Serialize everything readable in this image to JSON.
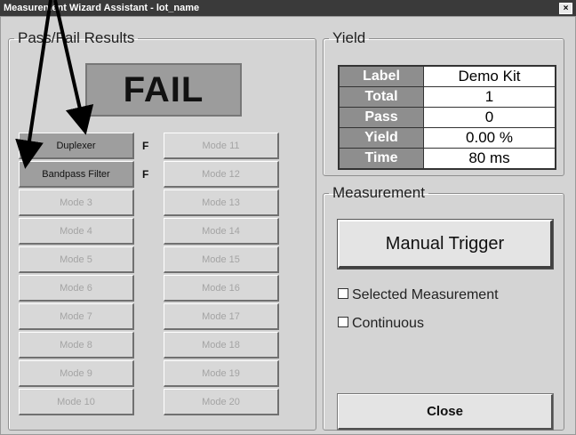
{
  "window": {
    "title": "Measurement Wizard Assistant - lot_name",
    "close_glyph": "×"
  },
  "pass_fail": {
    "legend": "Pass/Fail Results",
    "result": "FAIL",
    "modes_left": [
      {
        "label": "Duplexer",
        "status": "F",
        "active": true
      },
      {
        "label": "Bandpass Filter",
        "status": "F",
        "active": true
      },
      {
        "label": "Mode 3",
        "status": "",
        "active": false
      },
      {
        "label": "Mode 4",
        "status": "",
        "active": false
      },
      {
        "label": "Mode 5",
        "status": "",
        "active": false
      },
      {
        "label": "Mode 6",
        "status": "",
        "active": false
      },
      {
        "label": "Mode 7",
        "status": "",
        "active": false
      },
      {
        "label": "Mode 8",
        "status": "",
        "active": false
      },
      {
        "label": "Mode 9",
        "status": "",
        "active": false
      },
      {
        "label": "Mode 10",
        "status": "",
        "active": false
      }
    ],
    "modes_right": [
      {
        "label": "Mode 11"
      },
      {
        "label": "Mode 12"
      },
      {
        "label": "Mode 13"
      },
      {
        "label": "Mode 14"
      },
      {
        "label": "Mode 15"
      },
      {
        "label": "Mode 16"
      },
      {
        "label": "Mode 17"
      },
      {
        "label": "Mode 18"
      },
      {
        "label": "Mode 19"
      },
      {
        "label": "Mode 20"
      }
    ]
  },
  "yield": {
    "legend": "Yield",
    "rows": [
      {
        "label": "Label",
        "value": "Demo Kit"
      },
      {
        "label": "Total",
        "value": "1"
      },
      {
        "label": "Pass",
        "value": "0"
      },
      {
        "label": "Yield",
        "value": "0.00 %"
      },
      {
        "label": "Time",
        "value": "80 ms"
      }
    ]
  },
  "measurement": {
    "legend": "Measurement",
    "trigger_label": "Manual Trigger",
    "selected_label": "Selected Measurement",
    "selected_checked": false,
    "continuous_label": "Continuous",
    "continuous_checked": false,
    "close_label": "Close"
  }
}
